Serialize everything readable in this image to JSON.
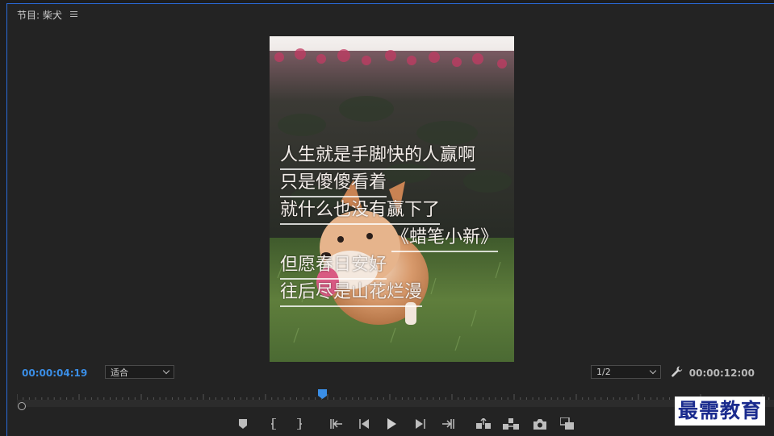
{
  "panel": {
    "title": "节目: 柴犬",
    "menu_icon": "hamburger-menu-icon",
    "accent_color": "#2a6ad8"
  },
  "video": {
    "subtitle_lines": [
      "人生就是手脚快的人赢啊",
      "只是傻傻看着",
      "就什么也没有赢下了"
    ],
    "signature": "《蜡笔小新》",
    "subtitle_lines_2": [
      "但愿春日安好",
      "往后尽是山花烂漫"
    ]
  },
  "controls": {
    "current_time": "00:00:04:19",
    "current_time_color": "#3a8ee6",
    "zoom_select": "适合",
    "quality_select": "1/2",
    "duration": "00:00:12:00",
    "wrench_icon": "wrench-icon"
  },
  "transport": {
    "buttons": [
      "add-marker-icon",
      "mark-in-icon",
      "mark-out-icon",
      "go-to-in-icon",
      "step-back-icon",
      "play-icon",
      "step-forward-icon",
      "go-to-out-icon",
      "lift-icon",
      "extract-icon",
      "export-frame-icon",
      "compare-view-icon"
    ]
  },
  "watermark": {
    "text": "最需教育"
  }
}
